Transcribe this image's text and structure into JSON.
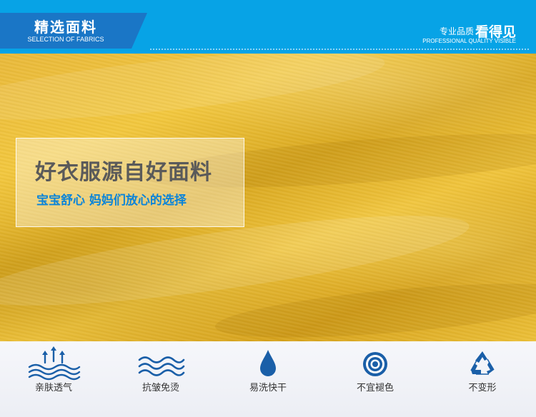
{
  "header": {
    "title": "精选面料",
    "subtitle": "SELECTION OF FABRICS",
    "quality_small": "专业品质",
    "quality_big": "看得见",
    "quality_en": "PROFESSIONAL QUALITY VISIBLE"
  },
  "hero": {
    "main_slogan": "好衣服源自好面料",
    "sub_slogan": "宝宝舒心 妈妈们放心的选择"
  },
  "features": [
    {
      "icon": "breathable-icon",
      "label": "亲肤透气"
    },
    {
      "icon": "wave-icon",
      "label": "抗皱免烫"
    },
    {
      "icon": "water-drop-icon",
      "label": "易洗快干"
    },
    {
      "icon": "target-icon",
      "label": "不宜褪色"
    },
    {
      "icon": "recycle-icon",
      "label": "不变形"
    }
  ],
  "colors": {
    "header_blue": "#07a3e6",
    "tab_blue": "#1a76c6",
    "icon_blue": "#1a5fa8",
    "accent_blue": "#0a84d8",
    "fabric_yellow": "#e9b93a"
  }
}
